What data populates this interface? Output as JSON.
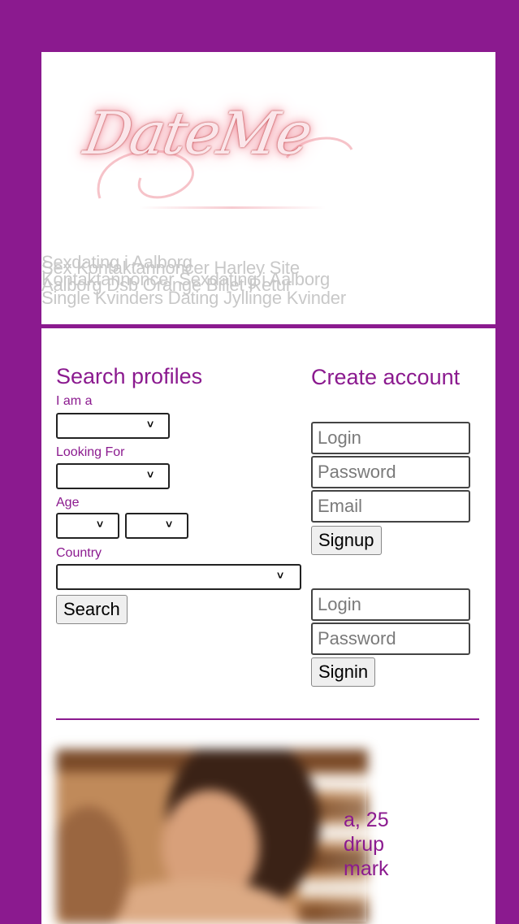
{
  "header": {
    "logo_text": "DateMe",
    "seo_lines": [
      "Sexdating i Aalborg",
      "Sex Kontaktannoncer Harley Site",
      "Aalborg Dsb Orange Billet Retur",
      "Kontaktannoncer Sexdating i Aalborg",
      "Single Kvinders Dating Jyllinge Kvinder"
    ]
  },
  "search": {
    "title": "Search profiles",
    "i_am_label": "I am a",
    "looking_for_label": "Looking For",
    "age_label": "Age",
    "country_label": "Country",
    "button": "Search"
  },
  "signup": {
    "title": "Create account",
    "login_placeholder": "Login",
    "password_placeholder": "Password",
    "email_placeholder": "Email",
    "button": "Signup"
  },
  "signin": {
    "login_placeholder": "Login",
    "password_placeholder": "Password",
    "button": "Signin"
  },
  "profile": {
    "line1": "a, 25",
    "line2": "drup",
    "line3": "mark"
  },
  "colors": {
    "brand": "#8b1a8f",
    "seo_text": "#c8c8c8"
  }
}
